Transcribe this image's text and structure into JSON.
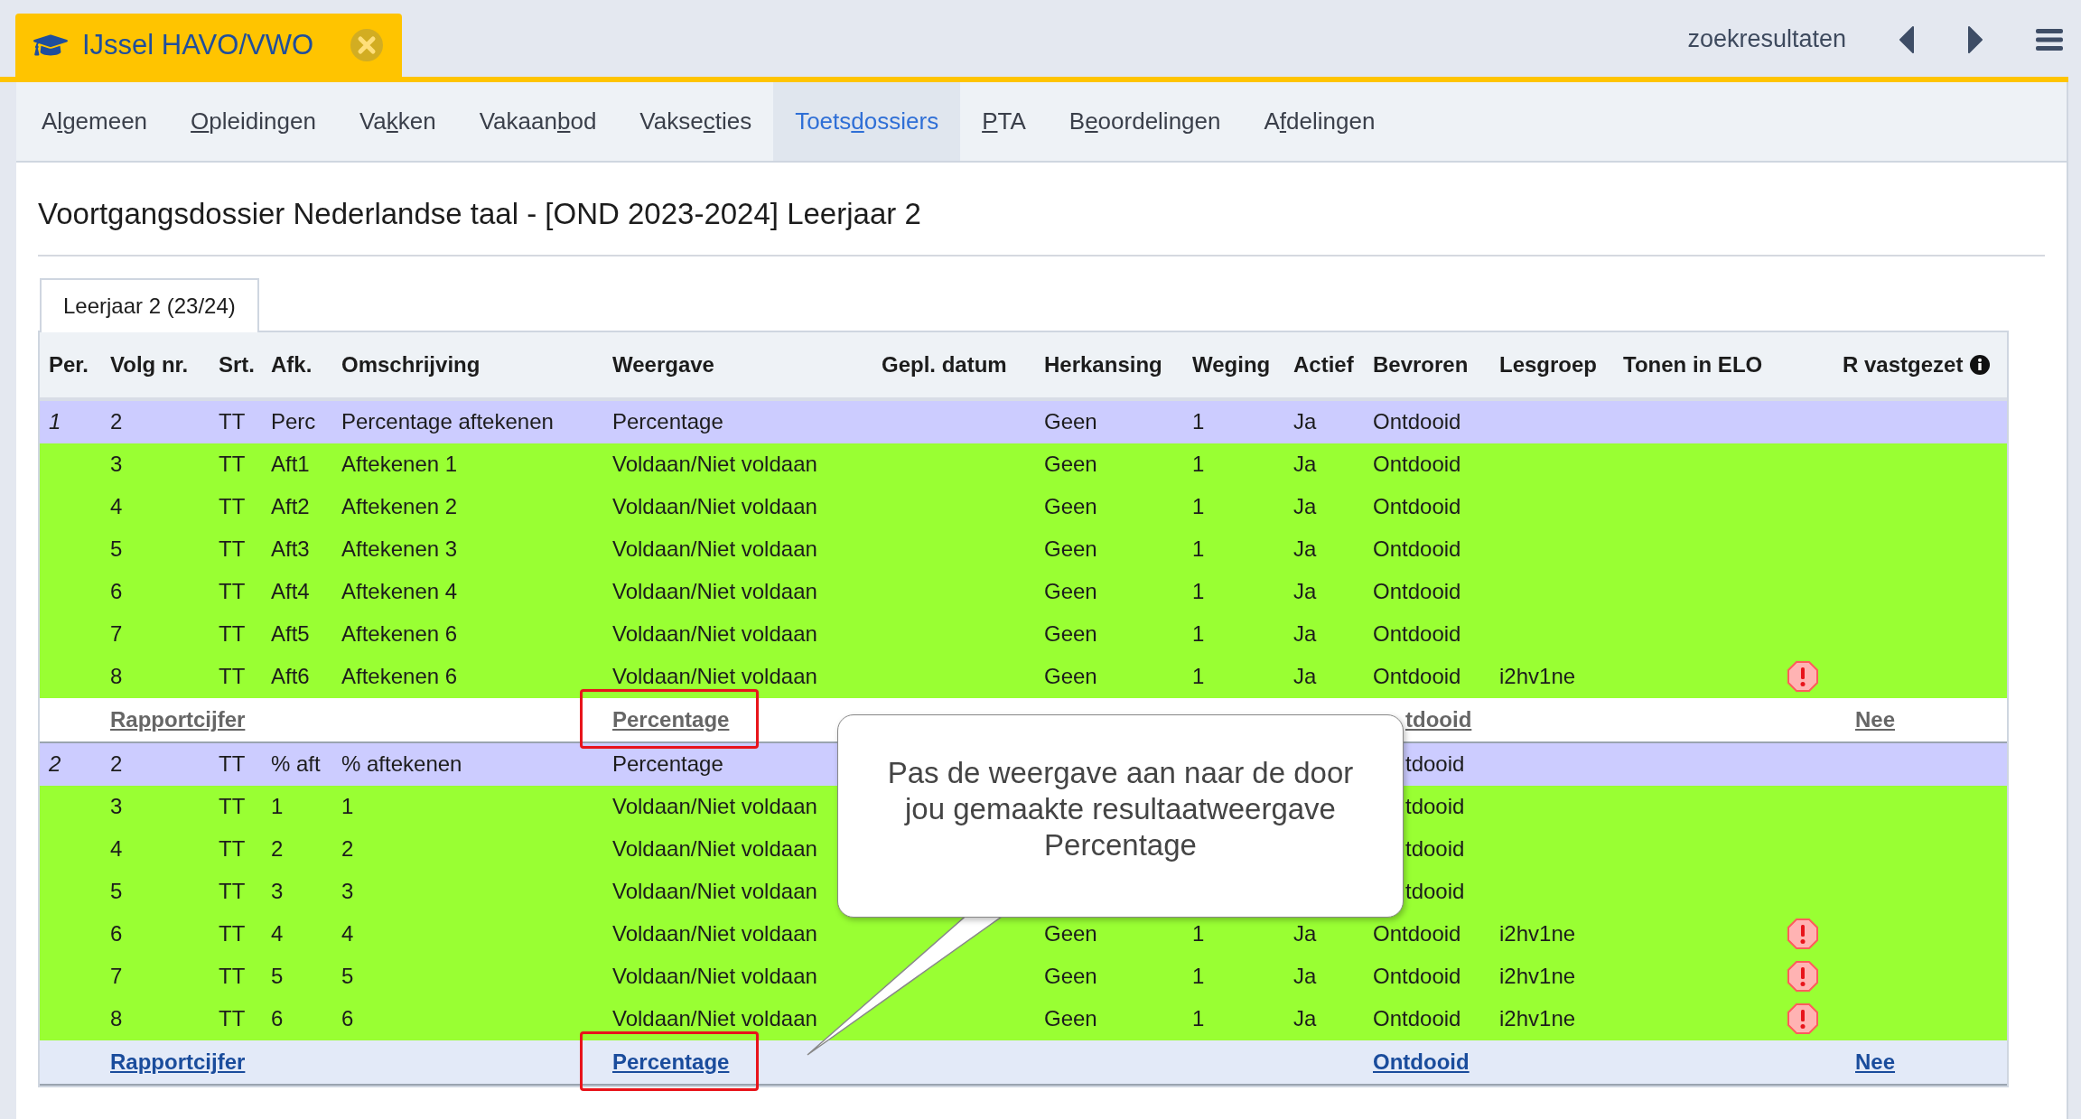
{
  "app_tab": {
    "title": "IJssel HAVO/VWO"
  },
  "top_right": {
    "label": "zoekresultaten"
  },
  "nav": [
    {
      "pre": "A",
      "key": "l",
      "post": "gemeen",
      "selected": false
    },
    {
      "key": "O",
      "post": "pleidingen",
      "selected": false
    },
    {
      "pre": "Va",
      "key": "k",
      "post": "ken",
      "selected": false
    },
    {
      "pre": "Vakaan",
      "key": "b",
      "post": "od",
      "selected": false
    },
    {
      "pre": "Vakse",
      "key": "c",
      "post": "ties",
      "selected": false
    },
    {
      "pre": "Toets",
      "key": "d",
      "post": "ossiers",
      "selected": true
    },
    {
      "key": "P",
      "post": "TA",
      "selected": false
    },
    {
      "pre": "B",
      "key": "e",
      "post": "oordelingen",
      "selected": false
    },
    {
      "pre": "A",
      "key": "f",
      "post": "delingen",
      "selected": false
    }
  ],
  "page_title": "Voortgangsdossier Nederlandse taal - [OND 2023-2024] Leerjaar 2",
  "year_tabs": [
    {
      "label": "Leerjaar 2 (23/24)",
      "selected": true
    }
  ],
  "table": {
    "columns": [
      "Per.",
      "Volg nr.",
      "Srt.",
      "Afk.",
      "Omschrijving",
      "Weergave",
      "Gepl. datum",
      "Herkansing",
      "Weging",
      "Actief",
      "Bevroren",
      "Lesgroep",
      "Tonen in ELO",
      "R vastgezet"
    ],
    "rows": [
      {
        "kind": "period",
        "per": "1",
        "volg": "2",
        "srt": "TT",
        "afk": "Perc",
        "omschrijving": "Percentage aftekenen",
        "weergave": "Percentage",
        "herkansing": "Geen",
        "weging": "1",
        "actief": "Ja",
        "bevroren": "Ontdooid",
        "covered": false,
        "warning": false
      },
      {
        "kind": "item",
        "volg": "3",
        "srt": "TT",
        "afk": "Aft1",
        "omschrijving": "Aftekenen 1",
        "weergave": "Voldaan/Niet voldaan",
        "herkansing": "Geen",
        "weging": "1",
        "actief": "Ja",
        "bevroren": "Ontdooid",
        "covered": false,
        "warning": false
      },
      {
        "kind": "item",
        "volg": "4",
        "srt": "TT",
        "afk": "Aft2",
        "omschrijving": "Aftekenen 2",
        "weergave": "Voldaan/Niet voldaan",
        "herkansing": "Geen",
        "weging": "1",
        "actief": "Ja",
        "bevroren": "Ontdooid",
        "covered": false,
        "warning": false
      },
      {
        "kind": "item",
        "volg": "5",
        "srt": "TT",
        "afk": "Aft3",
        "omschrijving": "Aftekenen 3",
        "weergave": "Voldaan/Niet voldaan",
        "herkansing": "Geen",
        "weging": "1",
        "actief": "Ja",
        "bevroren": "Ontdooid",
        "covered": false,
        "warning": false
      },
      {
        "kind": "item",
        "volg": "6",
        "srt": "TT",
        "afk": "Aft4",
        "omschrijving": "Aftekenen 4",
        "weergave": "Voldaan/Niet voldaan",
        "herkansing": "Geen",
        "weging": "1",
        "actief": "Ja",
        "bevroren": "Ontdooid",
        "covered": false,
        "warning": false
      },
      {
        "kind": "item",
        "volg": "7",
        "srt": "TT",
        "afk": "Aft5",
        "omschrijving": "Aftekenen 6",
        "weergave": "Voldaan/Niet voldaan",
        "herkansing": "Geen",
        "weging": "1",
        "actief": "Ja",
        "bevroren": "Ontdooid",
        "covered": false,
        "warning": false
      },
      {
        "kind": "item",
        "volg": "8",
        "srt": "TT",
        "afk": "Aft6",
        "omschrijving": "Aftekenen 6",
        "weergave": "Voldaan/Niet voldaan",
        "herkansing": "Geen",
        "weging": "1",
        "actief": "Ja",
        "bevroren": "Ontdooid",
        "lesgroep": "i2hv1ne",
        "covered": false,
        "warning": true
      },
      {
        "kind": "footer",
        "volg": "Rapportcijfer",
        "weergave": "Percentage",
        "outlined": true,
        "bevroren": "tdooid",
        "covered": true,
        "r_vastgezet": "Nee",
        "highlighted": false
      },
      {
        "kind": "period",
        "per": "2",
        "volg": "2",
        "srt": "TT",
        "afk": "% aft",
        "omschrijving": "% aftekenen",
        "weergave": "Percentage",
        "bevroren": "tdooid",
        "covered": true,
        "warning": false
      },
      {
        "kind": "item",
        "volg": "3",
        "srt": "TT",
        "afk": "1",
        "omschrijving": "1",
        "weergave": "Voldaan/Niet voldaan",
        "bevroren": "tdooid",
        "covered": true,
        "warning": false
      },
      {
        "kind": "item",
        "volg": "4",
        "srt": "TT",
        "afk": "2",
        "omschrijving": "2",
        "weergave": "Voldaan/Niet voldaan",
        "bevroren": "tdooid",
        "covered": true,
        "warning": false
      },
      {
        "kind": "item",
        "volg": "5",
        "srt": "TT",
        "afk": "3",
        "omschrijving": "3",
        "weergave": "Voldaan/Niet voldaan",
        "bevroren": "tdooid",
        "covered": true,
        "warning": false
      },
      {
        "kind": "item",
        "volg": "6",
        "srt": "TT",
        "afk": "4",
        "omschrijving": "4",
        "weergave": "Voldaan/Niet voldaan",
        "herkansing": "Geen",
        "weging": "1",
        "actief": "Ja",
        "bevroren": "Ontdooid",
        "lesgroep": "i2hv1ne",
        "covered": false,
        "warning": true
      },
      {
        "kind": "item",
        "volg": "7",
        "srt": "TT",
        "afk": "5",
        "omschrijving": "5",
        "weergave": "Voldaan/Niet voldaan",
        "herkansing": "Geen",
        "weging": "1",
        "actief": "Ja",
        "bevroren": "Ontdooid",
        "lesgroep": "i2hv1ne",
        "covered": false,
        "warning": true
      },
      {
        "kind": "item",
        "volg": "8",
        "srt": "TT",
        "afk": "6",
        "omschrijving": "6",
        "weergave": "Voldaan/Niet voldaan",
        "herkansing": "Geen",
        "weging": "1",
        "actief": "Ja",
        "bevroren": "Ontdooid",
        "lesgroep": "i2hv1ne",
        "covered": false,
        "warning": true
      },
      {
        "kind": "footer",
        "volg": "Rapportcijfer",
        "weergave": "Percentage",
        "outlined": true,
        "bevroren": "Ontdooid",
        "covered": false,
        "r_vastgezet": "Nee",
        "highlighted": true
      }
    ]
  },
  "callout": {
    "text": "Pas de weergave aan naar de door jou gemaakte resultaatweergave Percentage"
  }
}
